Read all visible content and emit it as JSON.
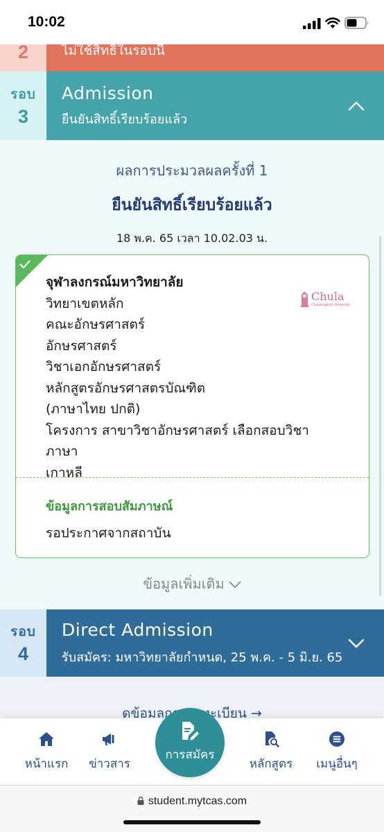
{
  "status_bar": {
    "time": "10:02"
  },
  "rounds": {
    "r2": {
      "number": "2",
      "status": "ไม่ใช้สิทธิ์ในรอบนี้",
      "color": "#e3725d"
    },
    "r3": {
      "word": "รอบ",
      "number": "3",
      "title": "Admission",
      "status": "ยืนยันสิทธิ์เรียบร้อยแล้ว",
      "color": "#45a3ac"
    },
    "r4": {
      "word": "รอบ",
      "number": "4",
      "title": "Direct Admission",
      "detail": "รับสมัคร: มหาวิทยาลัยกำหนด, 25 พ.ค. - 5 มิ.ย. 65",
      "color": "#2f6c99"
    }
  },
  "result": {
    "round_label": "ผลการประมวลผลครั้งที่ 1",
    "status": "ยืนยันสิทธิ์เรียบร้อยแล้ว",
    "timestamp": "18 พ.ค. 65 เวลา 10.02.03 น."
  },
  "card": {
    "university": "จุฬาลงกรณ์มหาวิทยาลัย",
    "lines": [
      "วิทยาเขตหลัก",
      "คณะอักษรศาสตร์",
      "อักษรศาสตร์",
      "วิชาเอกอักษรศาสตร์",
      "หลักสูตรอักษรศาสตรบัณฑิต",
      "(ภาษาไทย ปกติ)",
      "โครงการ สาขาวิชาอักษรศาสตร์ เลือกสอบวิชาภาษา",
      "เกาหลี"
    ],
    "logo_text": "Chula",
    "logo_subtext": "Chulalongkorn University",
    "interview_title": "ข้อมูลการสอบสัมภาษณ์",
    "interview_value": "รอประกาศจากสถาบัน"
  },
  "more_info": "ข้อมูลเพิ่มเติม",
  "register_link": "ดูข้อมูลการลงทะเบียน →",
  "nav": {
    "home": "หน้าแรก",
    "news": "ข่าวสาร",
    "apply": "การสมัคร",
    "courses": "หลักสูตร",
    "more": "เมนูอื่นๆ"
  },
  "browser": {
    "url": "student.mytcas.com"
  }
}
